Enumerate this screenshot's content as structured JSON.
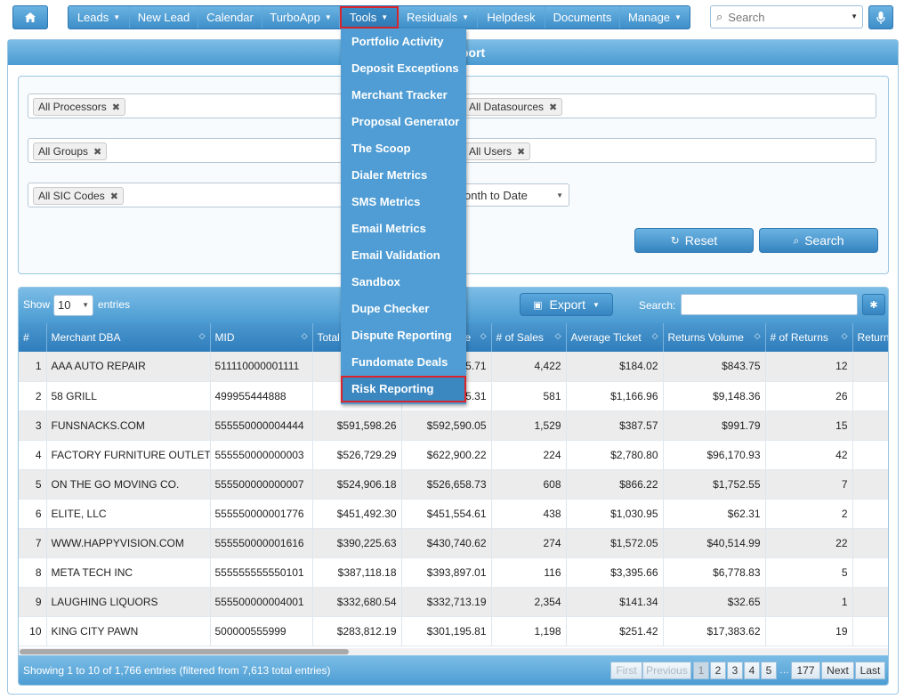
{
  "topnav": {
    "items": [
      {
        "label": "Leads",
        "caret": true
      },
      {
        "label": "New Lead",
        "caret": false
      },
      {
        "label": "Calendar",
        "caret": false
      },
      {
        "label": "TurboApp",
        "caret": true
      },
      {
        "label": "Tools",
        "caret": true
      },
      {
        "label": "Residuals",
        "caret": true
      },
      {
        "label": "Helpdesk",
        "caret": false
      },
      {
        "label": "Documents",
        "caret": false
      },
      {
        "label": "Manage",
        "caret": true
      }
    ],
    "search_placeholder": "Search",
    "icons": {
      "home": "home-icon",
      "search": "search-icon",
      "mic": "microphone-icon"
    }
  },
  "tools_menu": {
    "items": [
      "Portfolio Activity",
      "Deposit Exceptions",
      "Merchant Tracker",
      "Proposal Generator",
      "The Scoop",
      "Dialer Metrics",
      "SMS Metrics",
      "Email Metrics",
      "Email Validation",
      "Sandbox",
      "Dupe Checker",
      "Dispute Reporting",
      "Fundomate Deals",
      "Risk Reporting"
    ],
    "highlighted": "Risk Reporting"
  },
  "panel": {
    "title_visible": "port"
  },
  "filters": {
    "processors": "All Processors",
    "datasources": "All Datasources",
    "groups": "All Groups",
    "users": "All Users",
    "sic_codes": "All SIC Codes",
    "date_range": "onth to Date",
    "reset_label": "Reset",
    "search_label": "Search"
  },
  "table_tools": {
    "show_label": "Show",
    "entries_label": "entries",
    "page_length": "10",
    "export_label": "Export",
    "search_label": "Search:"
  },
  "table": {
    "columns": [
      "#",
      "Merchant DBA",
      "MID",
      "Total",
      "e",
      "# of Sales",
      "Average Ticket",
      "Returns Volume",
      "# of Returns",
      "Return"
    ],
    "rows": [
      {
        "n": "1",
        "dba": "AAA AUTO REPAIR",
        "mid": "511110000001111",
        "total": "",
        "vol": "5.71",
        "sales": "4,422",
        "avg": "$184.02",
        "ret_vol": "$843.75",
        "ret_n": "12"
      },
      {
        "n": "2",
        "dba": "58 GRILL",
        "mid": "499955444888",
        "total": "",
        "vol": "5.31",
        "sales": "581",
        "avg": "$1,166.96",
        "ret_vol": "$9,148.36",
        "ret_n": "26"
      },
      {
        "n": "3",
        "dba": "FUNSNACKS.COM",
        "mid": "555550000004444",
        "total": "$591,598.26",
        "vol": "$592,590.05",
        "sales": "1,529",
        "avg": "$387.57",
        "ret_vol": "$991.79",
        "ret_n": "15"
      },
      {
        "n": "4",
        "dba": "FACTORY FURNITURE OUTLET",
        "mid": "555550000000003",
        "total": "$526,729.29",
        "vol": "$622,900.22",
        "sales": "224",
        "avg": "$2,780.80",
        "ret_vol": "$96,170.93",
        "ret_n": "42"
      },
      {
        "n": "5",
        "dba": "ON THE GO MOVING CO.",
        "mid": "555500000000007",
        "total": "$524,906.18",
        "vol": "$526,658.73",
        "sales": "608",
        "avg": "$866.22",
        "ret_vol": "$1,752.55",
        "ret_n": "7"
      },
      {
        "n": "6",
        "dba": "ELITE, LLC",
        "mid": "555550000001776",
        "total": "$451,492.30",
        "vol": "$451,554.61",
        "sales": "438",
        "avg": "$1,030.95",
        "ret_vol": "$62.31",
        "ret_n": "2"
      },
      {
        "n": "7",
        "dba": "WWW.HAPPYVISION.COM",
        "mid": "555550000001616",
        "total": "$390,225.63",
        "vol": "$430,740.62",
        "sales": "274",
        "avg": "$1,572.05",
        "ret_vol": "$40,514.99",
        "ret_n": "22"
      },
      {
        "n": "8",
        "dba": "META TECH INC",
        "mid": "555555555550101",
        "total": "$387,118.18",
        "vol": "$393,897.01",
        "sales": "116",
        "avg": "$3,395.66",
        "ret_vol": "$6,778.83",
        "ret_n": "5"
      },
      {
        "n": "9",
        "dba": "LAUGHING LIQUORS",
        "mid": "555500000004001",
        "total": "$332,680.54",
        "vol": "$332,713.19",
        "sales": "2,354",
        "avg": "$141.34",
        "ret_vol": "$32.65",
        "ret_n": "1"
      },
      {
        "n": "10",
        "dba": "KING CITY PAWN",
        "mid": "500000555999",
        "total": "$283,812.19",
        "vol": "$301,195.81",
        "sales": "1,198",
        "avg": "$251.42",
        "ret_vol": "$17,383.62",
        "ret_n": "19"
      }
    ]
  },
  "footer": {
    "info": "Showing 1 to 10 of 1,766 entries (filtered from 7,613 total entries)",
    "first": "First",
    "previous": "Previous",
    "pages": [
      "1",
      "2",
      "3",
      "4",
      "5"
    ],
    "ellipsis": "…",
    "last_page": "177",
    "next": "Next",
    "last": "Last"
  },
  "colors": {
    "accent": "#4a9bd2",
    "highlight_border": "#d9242b",
    "menu_bg": "#4f9dd4"
  }
}
